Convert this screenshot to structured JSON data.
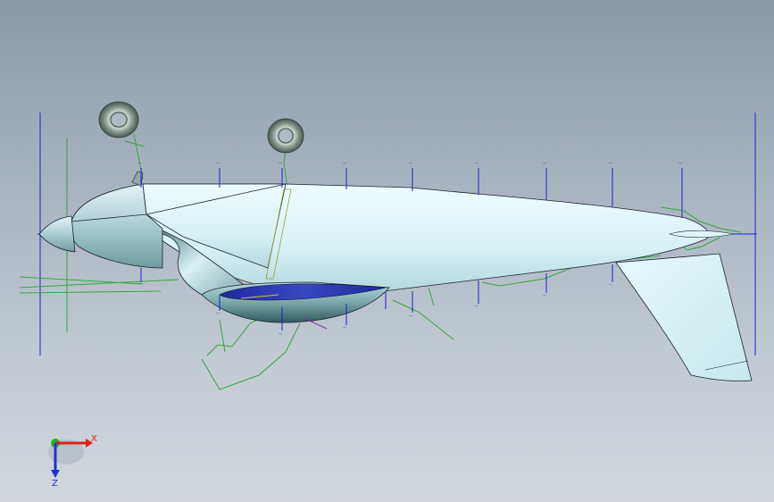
{
  "viewport": {
    "background_top": "#8d99a8",
    "background_bottom": "#d2d7dd"
  },
  "model": {
    "fuselage_color": "#dff6f8",
    "sketch_line_color": "#2fa83a",
    "construction_line_color": "#1a22d8",
    "station_labels_top": [
      "—",
      "—",
      "—",
      "—",
      "—",
      "—",
      "—",
      "—",
      "—"
    ],
    "station_labels_bottom": [
      "—",
      "—",
      "—",
      "—",
      "—",
      "—",
      "—",
      "—"
    ]
  },
  "triad": {
    "x_label": "X",
    "z_label": "Z",
    "x_color": "#e0201c",
    "y_color": "#22b030",
    "z_color": "#2030d0"
  }
}
